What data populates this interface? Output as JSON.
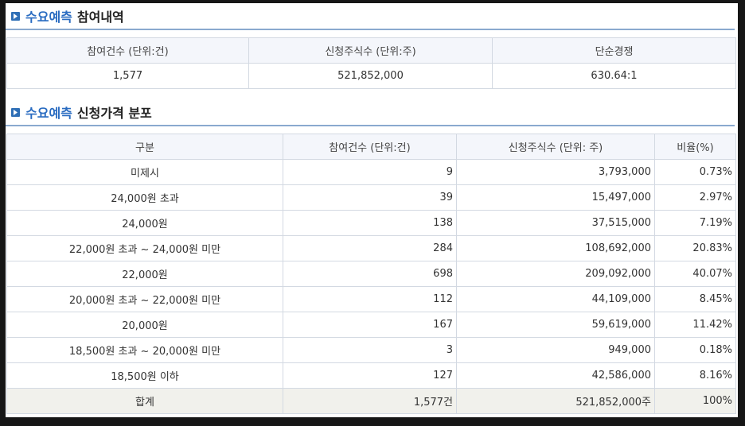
{
  "section1": {
    "title_highlight": "수요예측",
    "title_rest": "참여내역",
    "headers": [
      "참여건수 (단위:건)",
      "신청주식수 (단위:주)",
      "단순경쟁"
    ],
    "values": [
      "1,577",
      "521,852,000",
      "630.64:1"
    ]
  },
  "section2": {
    "title_highlight": "수요예측",
    "title_rest": "신청가격 분포",
    "headers": [
      "구분",
      "참여건수 (단위:건)",
      "신청주식수 (단위: 주)",
      "비율(%)"
    ],
    "rows": [
      [
        "미제시",
        "9",
        "3,793,000",
        "0.73%"
      ],
      [
        "24,000원 초과",
        "39",
        "15,497,000",
        "2.97%"
      ],
      [
        "24,000원",
        "138",
        "37,515,000",
        "7.19%"
      ],
      [
        "22,000원 초과 ~ 24,000원 미만",
        "284",
        "108,692,000",
        "20.83%"
      ],
      [
        "22,000원",
        "698",
        "209,092,000",
        "40.07%"
      ],
      [
        "20,000원 초과 ~ 22,000원 미만",
        "112",
        "44,109,000",
        "8.45%"
      ],
      [
        "20,000원",
        "167",
        "59,619,000",
        "11.42%"
      ],
      [
        "18,500원 초과 ~ 20,000원 미만",
        "3",
        "949,000",
        "0.18%"
      ],
      [
        "18,500원 이하",
        "127",
        "42,586,000",
        "8.16%"
      ]
    ],
    "total": [
      "합계",
      "1,577건",
      "521,852,000주",
      "100%"
    ]
  }
}
